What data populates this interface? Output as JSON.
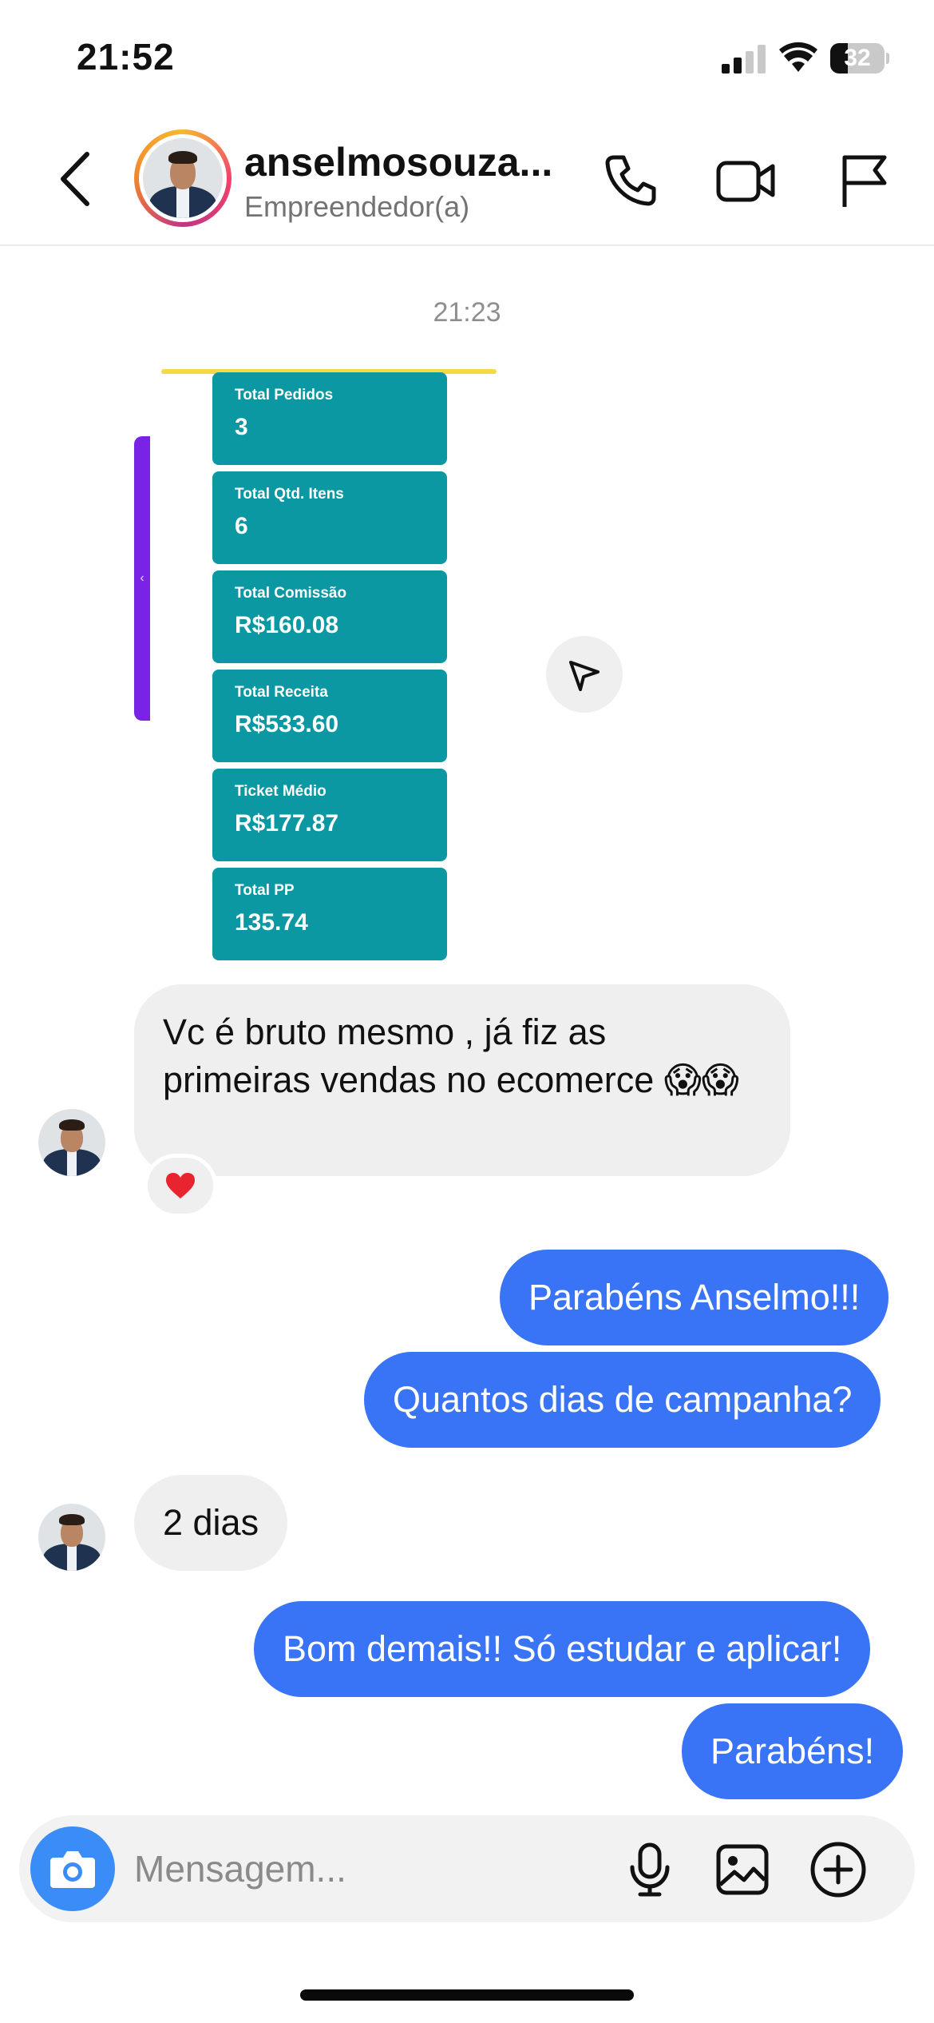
{
  "status_bar": {
    "time": "21:52",
    "battery_level": "32",
    "battery_fraction": 0.32
  },
  "header": {
    "contact_name": "anselmosouza...",
    "contact_subtitle": "Empreendedor(a)",
    "icons": [
      "chevron-left-icon",
      "phone-icon",
      "video-camera-icon",
      "flag-icon"
    ]
  },
  "chat": {
    "timestamp": "21:23",
    "report_cards": [
      {
        "label": "Total Pedidos",
        "value": "3"
      },
      {
        "label": "Total Qtd. Itens",
        "value": "6"
      },
      {
        "label": "Total Comissão",
        "value": "R$160.08"
      },
      {
        "label": "Total Receita",
        "value": "R$533.60"
      },
      {
        "label": "Ticket Médio",
        "value": "R$177.87"
      },
      {
        "label": "Total PP",
        "value": "135.74"
      }
    ],
    "report_side_arrow": "‹",
    "messages": [
      {
        "direction": "in",
        "text": "Vc é bruto mesmo , já fiz as primeiras vendas no ecomerce 😱😱",
        "reaction": "heart"
      },
      {
        "direction": "out",
        "text": "Parabéns Anselmo!!!"
      },
      {
        "direction": "out",
        "text": "Quantos dias de campanha?"
      },
      {
        "direction": "in",
        "text": "2 dias"
      },
      {
        "direction": "out",
        "text": "Bom demais!! Só estudar e aplicar!"
      },
      {
        "direction": "out",
        "text": "Parabéns!"
      }
    ]
  },
  "composer": {
    "placeholder": "Mensagem...",
    "icons": [
      "camera-icon",
      "microphone-icon",
      "image-icon",
      "plus-circle-icon"
    ]
  },
  "colors": {
    "outgoing_bubble": "#3a74f6",
    "incoming_bubble": "#efefef",
    "report_card": "#0b98a3",
    "report_strip": "#7a22e6",
    "camera_button": "#3a8df7"
  }
}
